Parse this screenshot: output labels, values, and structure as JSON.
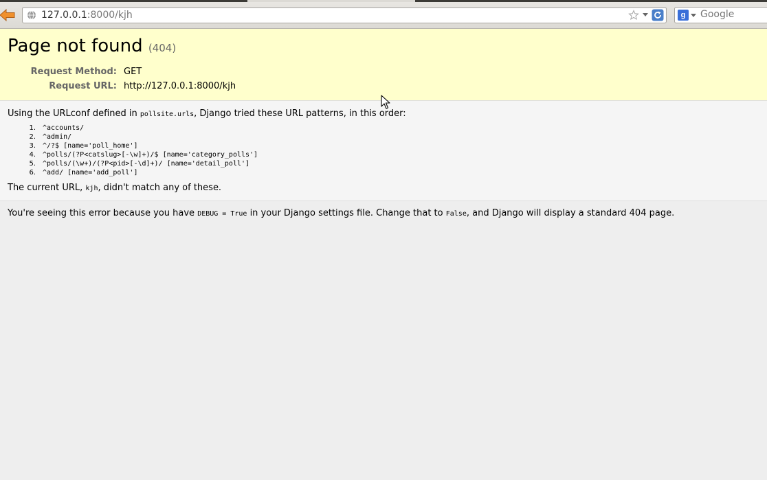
{
  "browser": {
    "url_host": "127.0.0.1",
    "url_rest": ":8000/kjh",
    "search_placeholder": "Google",
    "search_engine_glyph": "g",
    "accent": "#3a6fd8"
  },
  "error": {
    "title": "Page not found",
    "code": "(404)",
    "request_method_label": "Request Method:",
    "request_method": "GET",
    "request_url_label": "Request URL:",
    "request_url": "http://127.0.0.1:8000/kjh",
    "background": "#ffffcc"
  },
  "info": {
    "urlconf_prefix": "Using the URLconf defined in ",
    "urlconf_module": "pollsite.urls",
    "urlconf_suffix": ", Django tried these URL patterns, in this order:",
    "patterns": [
      {
        "num": "1.",
        "pattern": "^accounts/"
      },
      {
        "num": "2.",
        "pattern": "^admin/"
      },
      {
        "num": "3.",
        "pattern": "^/?$ [name='poll_home']"
      },
      {
        "num": "4.",
        "pattern": "^polls/(?P<catslug>[-\\w]+)/$ [name='category_polls']"
      },
      {
        "num": "5.",
        "pattern": "^polls/(\\w+)/(?P<pid>[-\\d]+)/ [name='detail_poll']"
      },
      {
        "num": "6.",
        "pattern": "^add/ [name='add_poll']"
      }
    ],
    "current_prefix": "The current URL, ",
    "current_url": "kjh",
    "current_suffix": ", didn't match any of these."
  },
  "explanation": {
    "prefix": "You're seeing this error because you have ",
    "debug_code": "DEBUG = True",
    "middle": " in your Django settings file. Change that to ",
    "false_code": "False",
    "suffix": ", and Django will display a standard 404 page."
  }
}
